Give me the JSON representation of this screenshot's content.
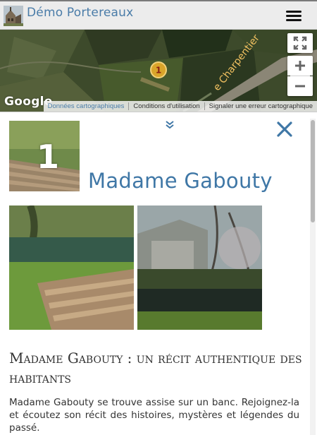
{
  "header": {
    "title": "Démo Portereaux",
    "logo_icon": "church-logo",
    "menu_icon": "hamburger-menu-icon"
  },
  "map": {
    "google_logo": "Google",
    "street_label": "e Charpentier",
    "marker_number": "1",
    "marker_color": "#d9a52a",
    "attribution": {
      "map_data": "Données cartographiques",
      "terms": "Conditions d'utilisation",
      "report": "Signaler une erreur cartographique"
    },
    "controls": {
      "fullscreen_icon": "fullscreen-icon",
      "zoom_in_icon": "plus-icon",
      "zoom_out_icon": "minus-icon"
    }
  },
  "panel": {
    "thumb_number": "1",
    "title": "Madame Gabouty",
    "collapse_icon": "double-chevron-down-icon",
    "close_icon": "close-icon",
    "accent_color": "#3f77a6",
    "photos": [
      "bench-by-river-photo",
      "river-and-trees-photo"
    ],
    "section_heading": "Madame Gabouty : un récit authentique des habitants",
    "body": "Madame Gabouty se trouve assise sur un banc. Rejoignez-la et écoutez son récit des histoires, mystères et légendes du passé."
  }
}
